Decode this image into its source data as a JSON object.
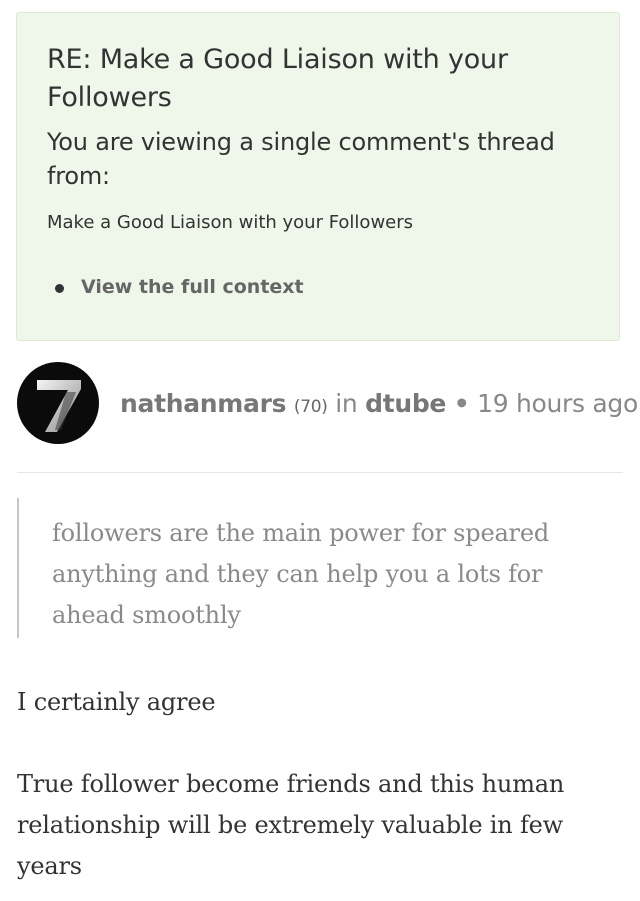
{
  "thread_header": {
    "title": "RE: Make a Good Liaison with your Followers",
    "subtitle": "You are viewing a single comment's thread from:",
    "source_post": "Make a Good Liaison with your Followers",
    "context_link": "View the full context"
  },
  "author": {
    "avatar_glyph": "7",
    "username": "nathanmars",
    "reputation": "(70)",
    "in_label": "in",
    "category": "dtube",
    "separator": "•",
    "time_ago": "19 hours ago"
  },
  "comment": {
    "quote": "followers are the main power for speared anything and they can help you a lots for ahead smoothly",
    "paragraphs": [
      "I certainly agree",
      "True follower become friends and this human relationship will be extremely valuable in few years"
    ]
  },
  "colors": {
    "thread_background": "#eef7e9",
    "text": "#333333",
    "muted_text": "#888888",
    "avatar_background": "#0b0b0b"
  }
}
